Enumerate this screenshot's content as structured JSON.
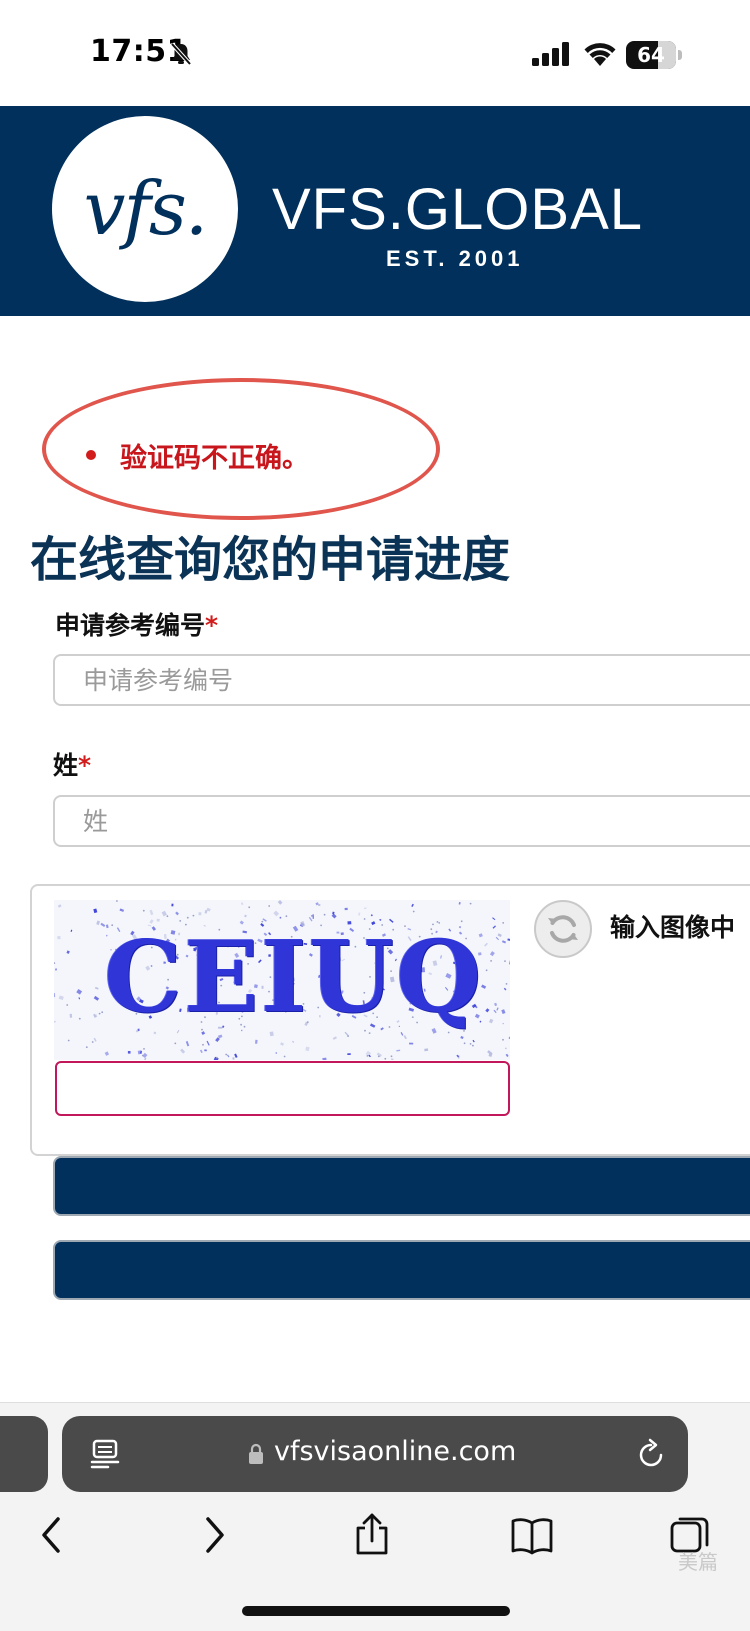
{
  "status_bar": {
    "time": "17:51",
    "battery_level": "64",
    "icons": [
      "bell-slash-icon",
      "cellular-signal-icon",
      "wifi-icon",
      "battery-icon"
    ]
  },
  "header": {
    "logo_mark": "vfs.",
    "brand_name": "VFS.GLOBAL",
    "established": "EST. 2001",
    "background_color": "#00305b"
  },
  "error": {
    "message": "验证码不正确。",
    "color": "#c8161d",
    "highlight_color": "#e0554c"
  },
  "page": {
    "title": "在线查询您的申请进度",
    "title_color": "#0b3355"
  },
  "form": {
    "reference": {
      "label": "申请参考编号",
      "required_mark": "*",
      "placeholder": "申请参考编号",
      "value": ""
    },
    "surname": {
      "label": "姓",
      "required_mark": "*",
      "placeholder": "姓",
      "value": ""
    },
    "captcha": {
      "image_text": "CEIUQ",
      "hint": "输入图像中",
      "value": "",
      "refresh_icon": "refresh-icon"
    },
    "buttons": {
      "primary_color": "#00305b"
    }
  },
  "browser": {
    "url": "vfsvisaonline.com",
    "toolbar_icons": [
      "back-icon",
      "forward-icon",
      "share-icon",
      "bookmarks-icon",
      "tabs-icon"
    ]
  },
  "watermark": "美篇"
}
